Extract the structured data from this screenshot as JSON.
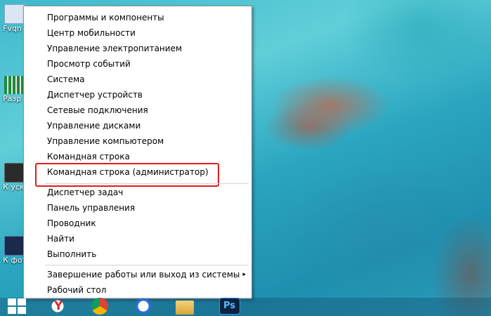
{
  "desktop": {
    "icons": [
      {
        "label": "Fvqn",
        "icon": "document-icon"
      },
      {
        "label": "Разр сост",
        "icon": "app-icon"
      },
      {
        "label": "К уско",
        "icon": "monitor-icon"
      },
      {
        "label": "К фото",
        "icon": "photo-icon"
      }
    ]
  },
  "menu": {
    "items": [
      {
        "label": "Программы и компоненты"
      },
      {
        "label": "Центр мобильности"
      },
      {
        "label": "Управление электропитанием"
      },
      {
        "label": "Просмотр событий"
      },
      {
        "label": "Система"
      },
      {
        "label": "Диспетчер устройств"
      },
      {
        "label": "Сетевые подключения"
      },
      {
        "label": "Управление дисками"
      },
      {
        "label": "Управление компьютером"
      },
      {
        "label": "Командная строка"
      },
      {
        "label": "Командная строка (администратор)",
        "highlighted": true
      },
      {
        "label": "Диспетчер задач"
      },
      {
        "label": "Панель управления"
      },
      {
        "label": "Проводник"
      },
      {
        "label": "Найти"
      },
      {
        "label": "Выполнить"
      },
      {
        "label": "Завершение работы или выход из системы",
        "has_submenu": true
      },
      {
        "label": "Рабочий стол"
      }
    ],
    "submenu_arrow": "▸",
    "highlight_color": "#e21b1b"
  },
  "taskbar": {
    "items": [
      {
        "name": "start-button",
        "icon": "windows-logo-icon"
      },
      {
        "name": "yandex-browser",
        "icon": "yandex-icon"
      },
      {
        "name": "chrome",
        "icon": "chrome-icon"
      },
      {
        "name": "thunderbird",
        "icon": "thunderbird-icon"
      },
      {
        "name": "file-explorer",
        "icon": "folder-icon"
      },
      {
        "name": "photoshop",
        "icon": "photoshop-icon"
      }
    ]
  }
}
